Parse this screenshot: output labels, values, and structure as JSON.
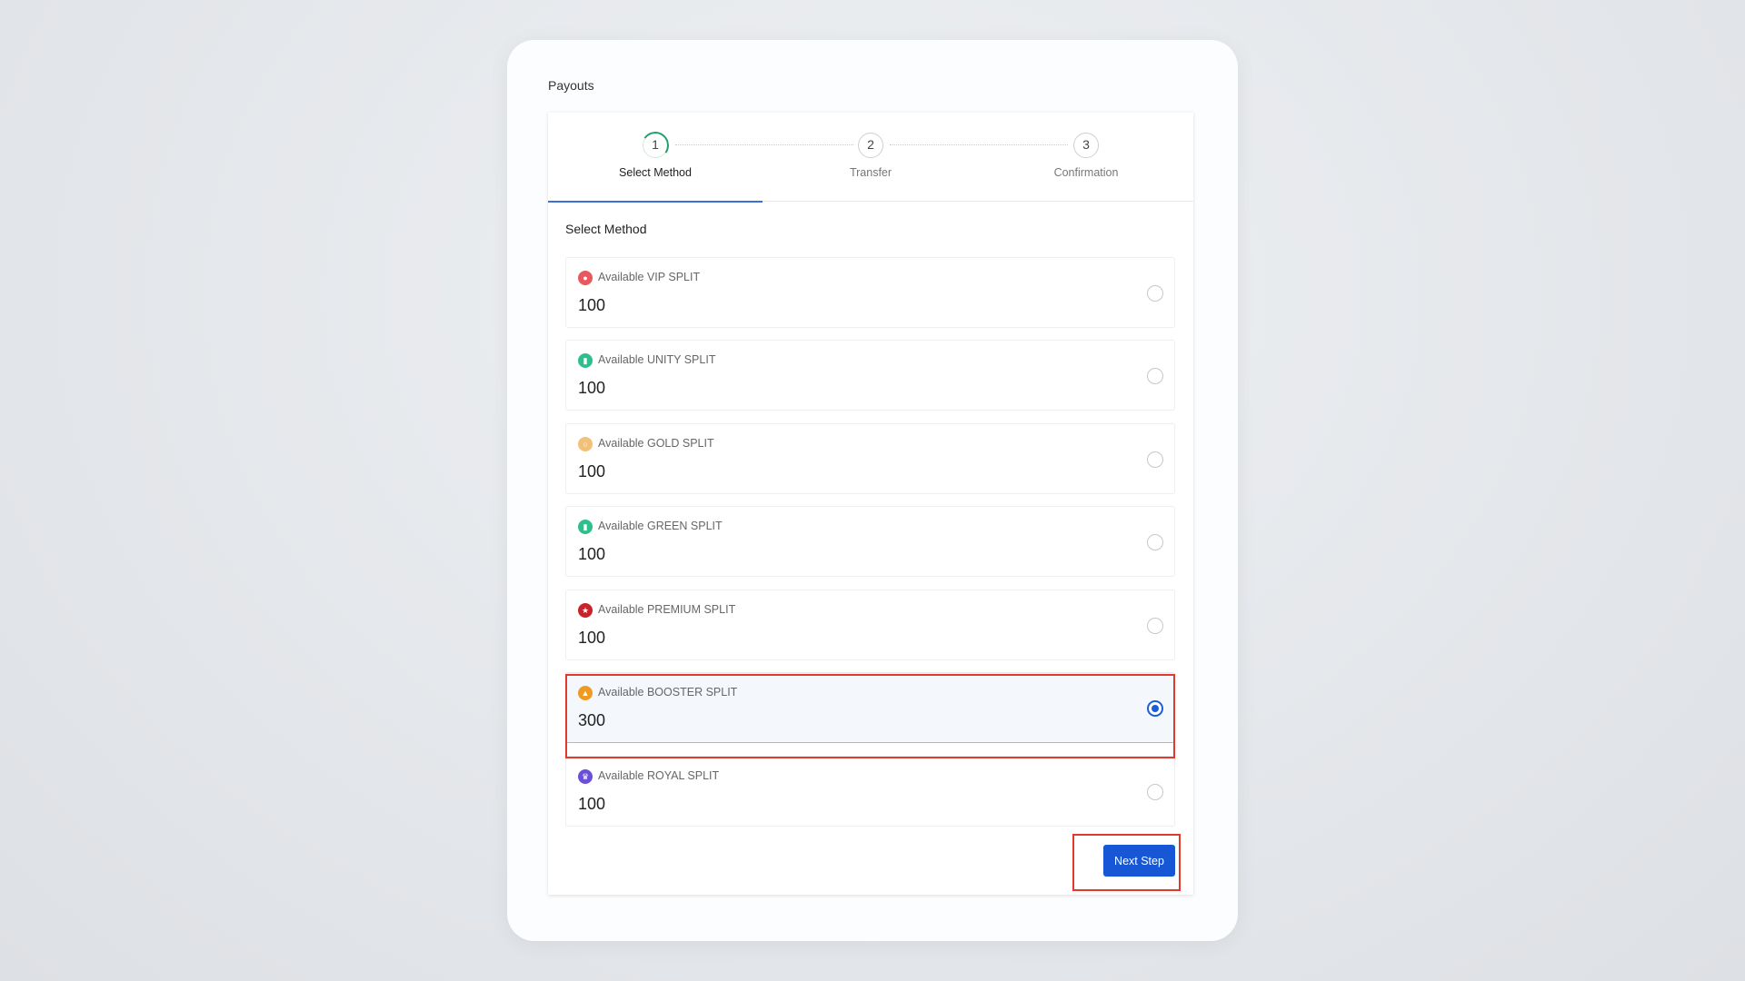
{
  "page": {
    "title": "Payouts"
  },
  "stepper": {
    "steps": [
      {
        "number": "1",
        "label": "Select Method",
        "active": true
      },
      {
        "number": "2",
        "label": "Transfer",
        "active": false
      },
      {
        "number": "3",
        "label": "Confirmation",
        "active": false
      }
    ]
  },
  "section": {
    "title": "Select Method"
  },
  "options": [
    {
      "label": "Available VIP SPLIT",
      "value": "100",
      "icon": "vip-icon",
      "color": "#e8585e",
      "selected": false
    },
    {
      "label": "Available UNITY SPLIT",
      "value": "100",
      "icon": "unity-icon",
      "color": "#2fbf8c",
      "selected": false
    },
    {
      "label": "Available GOLD SPLIT",
      "value": "100",
      "icon": "gold-icon",
      "color": "#f3c07a",
      "selected": false
    },
    {
      "label": "Available GREEN SPLIT",
      "value": "100",
      "icon": "green-icon",
      "color": "#2fbf8c",
      "selected": false
    },
    {
      "label": "Available PREMIUM SPLIT",
      "value": "100",
      "icon": "premium-star-icon",
      "color": "#c8232c",
      "selected": false
    },
    {
      "label": "Available BOOSTER SPLIT",
      "value": "300",
      "icon": "booster-icon",
      "color": "#f09a22",
      "selected": true
    },
    {
      "label": "Available ROYAL SPLIT",
      "value": "100",
      "icon": "royal-crown-icon",
      "color": "#6b4fd8",
      "selected": false
    }
  ],
  "actions": {
    "next_label": "Next Step"
  },
  "colors": {
    "primary": "#1757d6",
    "highlight": "#e13a2b",
    "step_active": "#22a06b"
  }
}
